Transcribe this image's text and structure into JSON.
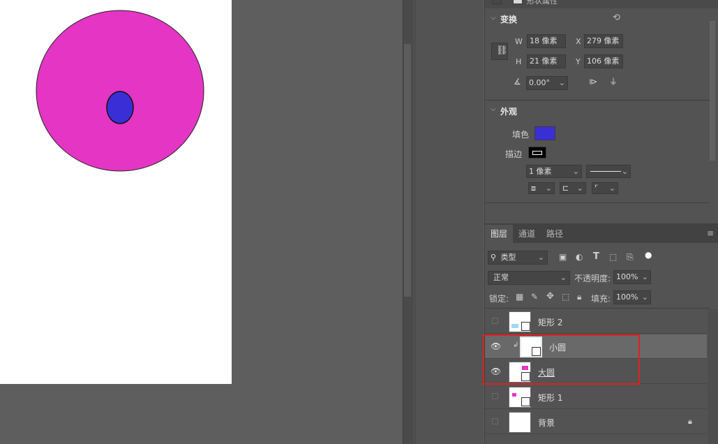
{
  "properties_panel": {
    "top_label": "形状属性",
    "transform": {
      "title": "变换",
      "w_label": "W",
      "w_value": "18 像素",
      "h_label": "H",
      "h_value": "21 像素",
      "x_label": "X",
      "x_value": "279 像素",
      "y_label": "Y",
      "y_value": "106 像素",
      "angle_value": "0.00°"
    },
    "appearance": {
      "title": "外观",
      "fill_label": "填色",
      "fill_color": "#3a2fd6",
      "stroke_label": "描边",
      "stroke_width": "1 像素"
    }
  },
  "layers_panel": {
    "tabs": [
      "图层",
      "通道",
      "路径"
    ],
    "filter_label": "类型",
    "blend_mode": "正常",
    "opacity_label": "不透明度:",
    "opacity_value": "100%",
    "lock_label": "锁定:",
    "fill_label": "填充:",
    "fill_value": "100%",
    "layers": [
      {
        "name": "矩形 2",
        "visible": false
      },
      {
        "name": "小圆",
        "visible": true,
        "selected": true
      },
      {
        "name": "大圆",
        "visible": true
      },
      {
        "name": "矩形 1",
        "visible": false
      },
      {
        "name": "背景",
        "visible": false,
        "locked": true
      }
    ]
  },
  "colors": {
    "big_circle": "#e535c4",
    "small_circle": "#3a2fd6",
    "highlight_box": "#e02020"
  }
}
